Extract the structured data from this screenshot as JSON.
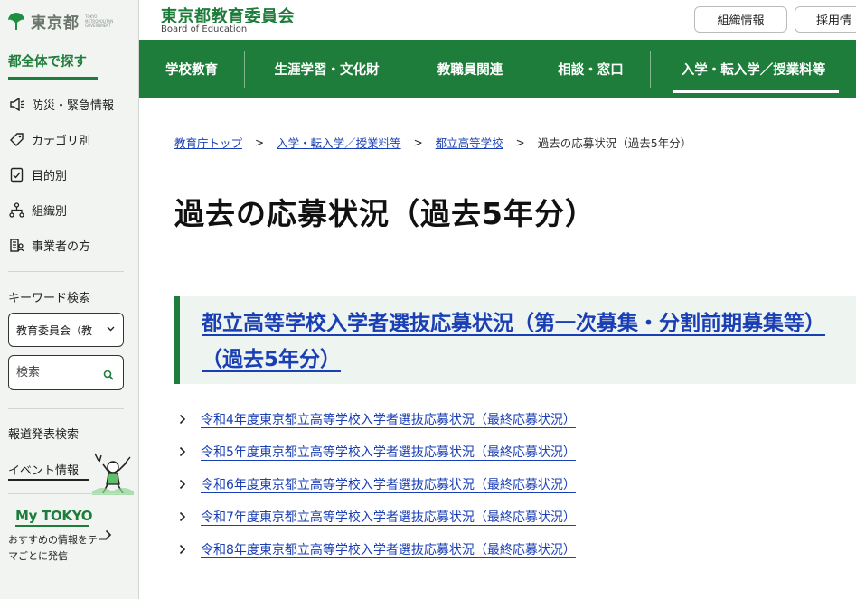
{
  "sidebar": {
    "logo_text": "東京都",
    "logo_sub": "TOKYO METROPOLITAN GOVERNMENT",
    "heading": "都全体で探す",
    "items": [
      {
        "label": "防災・緊急情報",
        "icon": "megaphone-icon"
      },
      {
        "label": "カテゴリ別",
        "icon": "tag-icon"
      },
      {
        "label": "目的別",
        "icon": "checklist-icon"
      },
      {
        "label": "組織別",
        "icon": "org-chart-icon"
      },
      {
        "label": "事業者の方",
        "icon": "business-icon"
      }
    ],
    "keyword_label": "キーワード検索",
    "scope_select": "教育委員会（教",
    "search_placeholder": "検索",
    "press_search": "報道発表検索",
    "event_info": "イベント情報",
    "mytokyo_logo": "My TOKYO",
    "mytokyo_desc": "おすすめの情報をテーマごとに発信"
  },
  "header": {
    "title": "東京都教育委員会",
    "subtitle": "Board of Education",
    "buttons": [
      "組織情報",
      "採用情"
    ]
  },
  "nav": {
    "items": [
      "学校教育",
      "生涯学習・文化財",
      "教職員関連",
      "相談・窓口",
      "入学・転入学／授業料等"
    ],
    "active_index": 4
  },
  "breadcrumb": {
    "links": [
      "教育庁トップ",
      "入学・転入学／授業料等",
      "都立高等学校"
    ],
    "current": "過去の応募状況（過去5年分）"
  },
  "main": {
    "page_title": "過去の応募状況（過去5年分）",
    "section_heading": "都立高等学校入学者選抜応募状況（第一次募集・分割前期募集等）（過去5年分）",
    "links": [
      "令和4年度東京都立高等学校入学者選抜応募状況（最終応募状況）",
      "令和5年度東京都立高等学校入学者選抜応募状況（最終応募状況）",
      "令和6年度東京都立高等学校入学者選抜応募状況（最終応募状況）",
      "令和7年度東京都立高等学校入学者選抜応募状況（最終応募状況）",
      "令和8年度東京都立高等学校入学者選抜応募状況（最終応募状況）"
    ]
  },
  "colors": {
    "brand_green": "#1e7d3a",
    "link_blue": "#1a3fb5",
    "sidebar_bg": "#f2f4f2",
    "section_bg": "#eef4ef"
  }
}
